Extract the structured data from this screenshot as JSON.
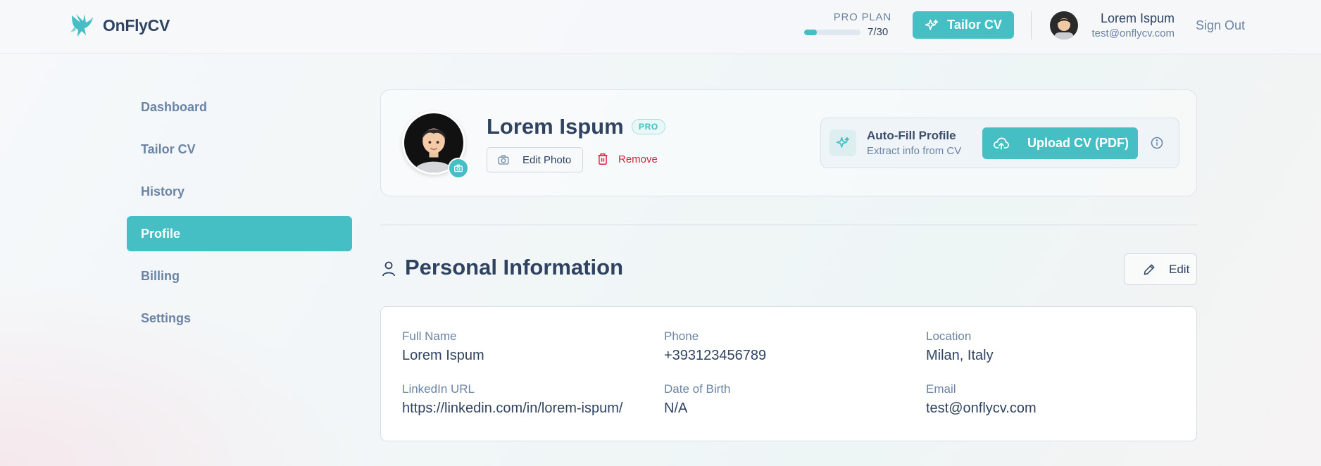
{
  "brand": {
    "name": "OnFlyCV"
  },
  "plan": {
    "label": "PRO PLAN",
    "count": "7/30",
    "progress": 0.23
  },
  "header": {
    "tailor_label": "Tailor CV",
    "user_name": "Lorem Ispum",
    "user_email": "test@onflycv.com",
    "signout_label": "Sign Out"
  },
  "sidebar": {
    "items": [
      {
        "label": "Dashboard"
      },
      {
        "label": "Tailor CV"
      },
      {
        "label": "History"
      },
      {
        "label": "Profile"
      },
      {
        "label": "Billing"
      },
      {
        "label": "Settings"
      }
    ],
    "active": "Profile"
  },
  "profile": {
    "name": "Lorem Ispum",
    "badge": "PRO",
    "edit_photo_label": "Edit Photo",
    "remove_label": "Remove",
    "autofill_title": "Auto-Fill Profile",
    "autofill_subtitle": "Extract info from CV",
    "upload_label": "Upload CV (PDF)"
  },
  "personal": {
    "title": "Personal Information",
    "edit_label": "Edit",
    "fields": [
      {
        "label": "Full Name",
        "value": "Lorem Ispum"
      },
      {
        "label": "Phone",
        "value": "+393123456789"
      },
      {
        "label": "Location",
        "value": "Milan, Italy"
      },
      {
        "label": "LinkedIn URL",
        "value": "https://linkedin.com/in/lorem-ispum/"
      },
      {
        "label": "Date of Birth",
        "value": "N/A"
      },
      {
        "label": "Email",
        "value": "test@onflycv.com"
      }
    ]
  },
  "colors": {
    "accent": "#45bec4",
    "text": "#2f4361",
    "muted": "#6b84a5",
    "danger": "#d8213f"
  },
  "icons": [
    "logo-bird-icon",
    "sparkle-icon",
    "camera-icon",
    "trash-icon",
    "upload-cloud-icon",
    "info-icon",
    "user-icon",
    "pencil-icon"
  ]
}
